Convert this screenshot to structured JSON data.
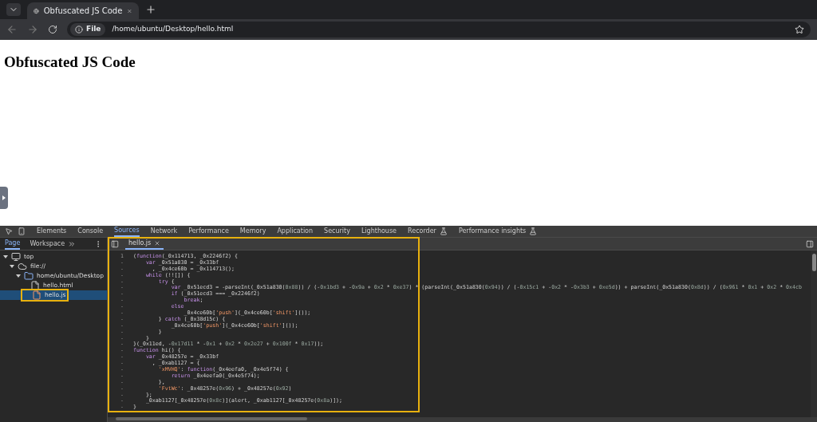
{
  "browser": {
    "tabs": [
      {
        "title": "Obfuscated JS Code",
        "selected": true
      }
    ],
    "address": {
      "scheme": "File",
      "url": "/home/ubuntu/Desktop/hello.html"
    }
  },
  "page": {
    "heading": "Obfuscated JS Code"
  },
  "devtools": {
    "tabs": [
      {
        "label": "Elements",
        "selected": false,
        "experimental": false
      },
      {
        "label": "Console",
        "selected": false,
        "experimental": false
      },
      {
        "label": "Sources",
        "selected": true,
        "experimental": false
      },
      {
        "label": "Network",
        "selected": false,
        "experimental": false
      },
      {
        "label": "Performance",
        "selected": false,
        "experimental": false
      },
      {
        "label": "Memory",
        "selected": false,
        "experimental": false
      },
      {
        "label": "Application",
        "selected": false,
        "experimental": false
      },
      {
        "label": "Security",
        "selected": false,
        "experimental": false
      },
      {
        "label": "Lighthouse",
        "selected": false,
        "experimental": false
      },
      {
        "label": "Recorder",
        "selected": false,
        "experimental": true
      },
      {
        "label": "Performance insights",
        "selected": false,
        "experimental": true
      }
    ],
    "sidebar_tabs": [
      {
        "label": "Page",
        "selected": true
      },
      {
        "label": "Workspace",
        "selected": false
      }
    ],
    "tree": [
      {
        "kind": "frame",
        "label": "top",
        "expanded": true,
        "selected": false,
        "highlighted": false,
        "children": [
          {
            "kind": "origin",
            "label": "file://",
            "expanded": true,
            "selected": false,
            "highlighted": false,
            "children": [
              {
                "kind": "folder",
                "label": "home/ubuntu/Desktop",
                "expanded": true,
                "selected": false,
                "highlighted": false,
                "children": [
                  {
                    "kind": "file",
                    "label": "hello.html",
                    "selected": false,
                    "highlighted": false
                  },
                  {
                    "kind": "script",
                    "label": "hello.js",
                    "selected": true,
                    "highlighted": true
                  }
                ]
              }
            ]
          }
        ]
      }
    ],
    "editor": {
      "highlighted": true,
      "file_tab": "hello.js",
      "lines": [
        {
          "n": "1",
          "segs": [
            {
              "kind": "text",
              "text": "("
            },
            {
              "kind": "keyword",
              "text": "function"
            },
            {
              "kind": "text",
              "text": "(_0x114713, _0x2246f2) {"
            }
          ]
        },
        {
          "n": "-",
          "segs": [
            {
              "kind": "keyword",
              "text": "    var"
            },
            {
              "kind": "text",
              "text": " _0x51a830 = _0x33bf"
            }
          ]
        },
        {
          "n": "-",
          "segs": [
            {
              "kind": "text",
              "text": "      , _0x4ce60b = _0x114713();"
            }
          ]
        },
        {
          "n": "-",
          "segs": [
            {
              "kind": "keyword",
              "text": "    while"
            },
            {
              "kind": "text",
              "text": " (!![]) {"
            }
          ]
        },
        {
          "n": "-",
          "segs": [
            {
              "kind": "keyword",
              "text": "        try"
            },
            {
              "kind": "text",
              "text": " {"
            }
          ]
        },
        {
          "n": "-",
          "segs": [
            {
              "kind": "keyword",
              "text": "            var"
            },
            {
              "kind": "text",
              "text": " _0x51ecd3 = -parseInt(_0x51a830("
            },
            {
              "kind": "number",
              "text": "0x88"
            },
            {
              "kind": "text",
              "text": ")) / (-"
            },
            {
              "kind": "number",
              "text": "0x1bd3"
            },
            {
              "kind": "text",
              "text": " + -"
            },
            {
              "kind": "number",
              "text": "0x9a"
            },
            {
              "kind": "text",
              "text": " + "
            },
            {
              "kind": "number",
              "text": "0x2"
            },
            {
              "kind": "text",
              "text": " * "
            },
            {
              "kind": "number",
              "text": "0xe37"
            },
            {
              "kind": "text",
              "text": ") * (parseInt(_0x51a830("
            },
            {
              "kind": "number",
              "text": "0x94"
            },
            {
              "kind": "text",
              "text": ")) / (-"
            },
            {
              "kind": "number",
              "text": "0x15c1"
            },
            {
              "kind": "text",
              "text": " + -"
            },
            {
              "kind": "number",
              "text": "0x2"
            },
            {
              "kind": "text",
              "text": " * -"
            },
            {
              "kind": "number",
              "text": "0x3b3"
            },
            {
              "kind": "text",
              "text": " + "
            },
            {
              "kind": "number",
              "text": "0xe5d"
            },
            {
              "kind": "text",
              "text": ")) + parseInt(_0x51a830("
            },
            {
              "kind": "number",
              "text": "0x8d"
            },
            {
              "kind": "text",
              "text": ")) / ("
            },
            {
              "kind": "number",
              "text": "0x961"
            },
            {
              "kind": "text",
              "text": " * "
            },
            {
              "kind": "number",
              "text": "0x1"
            },
            {
              "kind": "text",
              "text": " + "
            },
            {
              "kind": "number",
              "text": "0x2"
            },
            {
              "kind": "text",
              "text": " * "
            },
            {
              "kind": "number",
              "text": "0x4cb"
            }
          ]
        },
        {
          "n": "-",
          "segs": [
            {
              "kind": "keyword",
              "text": "            if"
            },
            {
              "kind": "text",
              "text": " (_0x51ecd3 === _0x2246f2)"
            }
          ]
        },
        {
          "n": "-",
          "segs": [
            {
              "kind": "keyword",
              "text": "                break"
            },
            {
              "kind": "text",
              "text": ";"
            }
          ]
        },
        {
          "n": "-",
          "segs": [
            {
              "kind": "keyword",
              "text": "            else"
            }
          ]
        },
        {
          "n": "-",
          "segs": [
            {
              "kind": "text",
              "text": "                _0x4ce60b["
            },
            {
              "kind": "string",
              "text": "'push'"
            },
            {
              "kind": "text",
              "text": "](_0x4ce60b["
            },
            {
              "kind": "string",
              "text": "'shift'"
            },
            {
              "kind": "text",
              "text": "]());"
            }
          ]
        },
        {
          "n": "-",
          "segs": [
            {
              "kind": "text",
              "text": "        } "
            },
            {
              "kind": "keyword",
              "text": "catch"
            },
            {
              "kind": "text",
              "text": " (_0x38d15c) {"
            }
          ]
        },
        {
          "n": "-",
          "segs": [
            {
              "kind": "text",
              "text": "            _0x4ce60b["
            },
            {
              "kind": "string",
              "text": "'push'"
            },
            {
              "kind": "text",
              "text": "](_0x4ce60b["
            },
            {
              "kind": "string",
              "text": "'shift'"
            },
            {
              "kind": "text",
              "text": "]());"
            }
          ]
        },
        {
          "n": "-",
          "segs": [
            {
              "kind": "text",
              "text": "        }"
            }
          ]
        },
        {
          "n": "-",
          "segs": [
            {
              "kind": "text",
              "text": "    }"
            }
          ]
        },
        {
          "n": "-",
          "segs": [
            {
              "kind": "text",
              "text": "}(_0x11ed, -"
            },
            {
              "kind": "number",
              "text": "0x17d11"
            },
            {
              "kind": "text",
              "text": " * -"
            },
            {
              "kind": "number",
              "text": "0x1"
            },
            {
              "kind": "text",
              "text": " + "
            },
            {
              "kind": "number",
              "text": "0x2"
            },
            {
              "kind": "text",
              "text": " * "
            },
            {
              "kind": "number",
              "text": "0x2e27"
            },
            {
              "kind": "text",
              "text": " + "
            },
            {
              "kind": "number",
              "text": "0x100f"
            },
            {
              "kind": "text",
              "text": " * "
            },
            {
              "kind": "number",
              "text": "0x17"
            },
            {
              "kind": "text",
              "text": "));"
            }
          ]
        },
        {
          "n": "-",
          "segs": [
            {
              "kind": "keyword",
              "text": "function"
            },
            {
              "kind": "text",
              "text": " hi() {"
            }
          ]
        },
        {
          "n": "-",
          "segs": [
            {
              "kind": "keyword",
              "text": "    var"
            },
            {
              "kind": "text",
              "text": " _0x48257e = _0x33bf"
            }
          ]
        },
        {
          "n": "-",
          "segs": [
            {
              "kind": "text",
              "text": "      , _0xab1127 = {"
            }
          ]
        },
        {
          "n": "-",
          "segs": [
            {
              "kind": "string",
              "text": "        'xMVHQ'"
            },
            {
              "kind": "text",
              "text": ": "
            },
            {
              "kind": "keyword",
              "text": "function"
            },
            {
              "kind": "text",
              "text": "(_0x4eefa0, _0x4e5f74) {"
            }
          ]
        },
        {
          "n": "-",
          "segs": [
            {
              "kind": "keyword",
              "text": "            return"
            },
            {
              "kind": "text",
              "text": " _0x4eefa0(_0x4e5f74);"
            }
          ]
        },
        {
          "n": "-",
          "segs": [
            {
              "kind": "text",
              "text": "        },"
            }
          ]
        },
        {
          "n": "-",
          "segs": [
            {
              "kind": "string",
              "text": "        'FvtWc'"
            },
            {
              "kind": "text",
              "text": ": _0x48257e("
            },
            {
              "kind": "number",
              "text": "0x96"
            },
            {
              "kind": "text",
              "text": ") + _0x48257e("
            },
            {
              "kind": "number",
              "text": "0x92"
            },
            {
              "kind": "text",
              "text": ")"
            }
          ]
        },
        {
          "n": "-",
          "segs": [
            {
              "kind": "text",
              "text": "    };"
            }
          ]
        },
        {
          "n": "-",
          "segs": [
            {
              "kind": "text",
              "text": "    _0xab1127[_0x48257e("
            },
            {
              "kind": "number",
              "text": "0x8c"
            },
            {
              "kind": "text",
              "text": ")](alert, _0xab1127[_0x48257e("
            },
            {
              "kind": "number",
              "text": "0x8a"
            },
            {
              "kind": "text",
              "text": ")]);"
            }
          ]
        },
        {
          "n": "-",
          "segs": [
            {
              "kind": "text",
              "text": "}"
            }
          ]
        }
      ]
    }
  }
}
